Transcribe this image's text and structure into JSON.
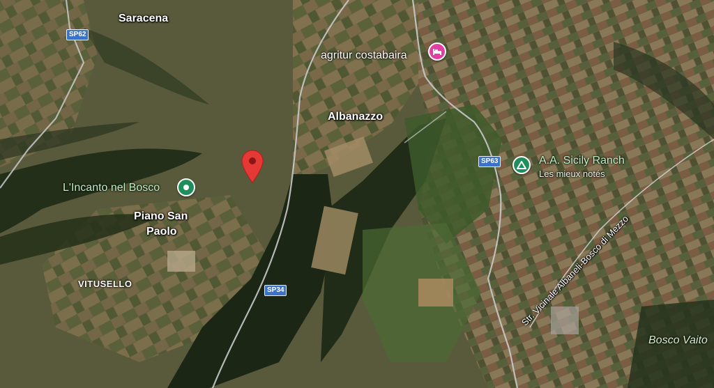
{
  "map": {
    "places": {
      "saracena": "Saracena",
      "albanazzo": "Albanazzo",
      "piano_line1": "Piano San",
      "piano_line2": "Paolo",
      "vitusello": "VITUSELLO"
    },
    "pois": {
      "agritur": {
        "name": "agritur costabaira",
        "icon": "hotel-bed-icon",
        "color": "#e23fa3"
      },
      "incanto": {
        "name": "L'Incanto nel Bosco",
        "icon": "park-dot-icon",
        "color": "#1e8e5a"
      },
      "ranch": {
        "name": "A.A. Sicily Ranch",
        "subtitle": "Les mieux notés",
        "icon": "campground-icon",
        "color": "#1e8e5a"
      }
    },
    "roads": {
      "sp62": "SP62",
      "sp63": "SP63",
      "sp34": "SP34",
      "vicinale": "Str. Vicinale Albaneli-Bosco di Mezzo"
    },
    "areas": {
      "bosco": "Bosco Vaito"
    },
    "marker": {
      "icon": "red-map-pin-icon",
      "color": "#e53935"
    }
  }
}
